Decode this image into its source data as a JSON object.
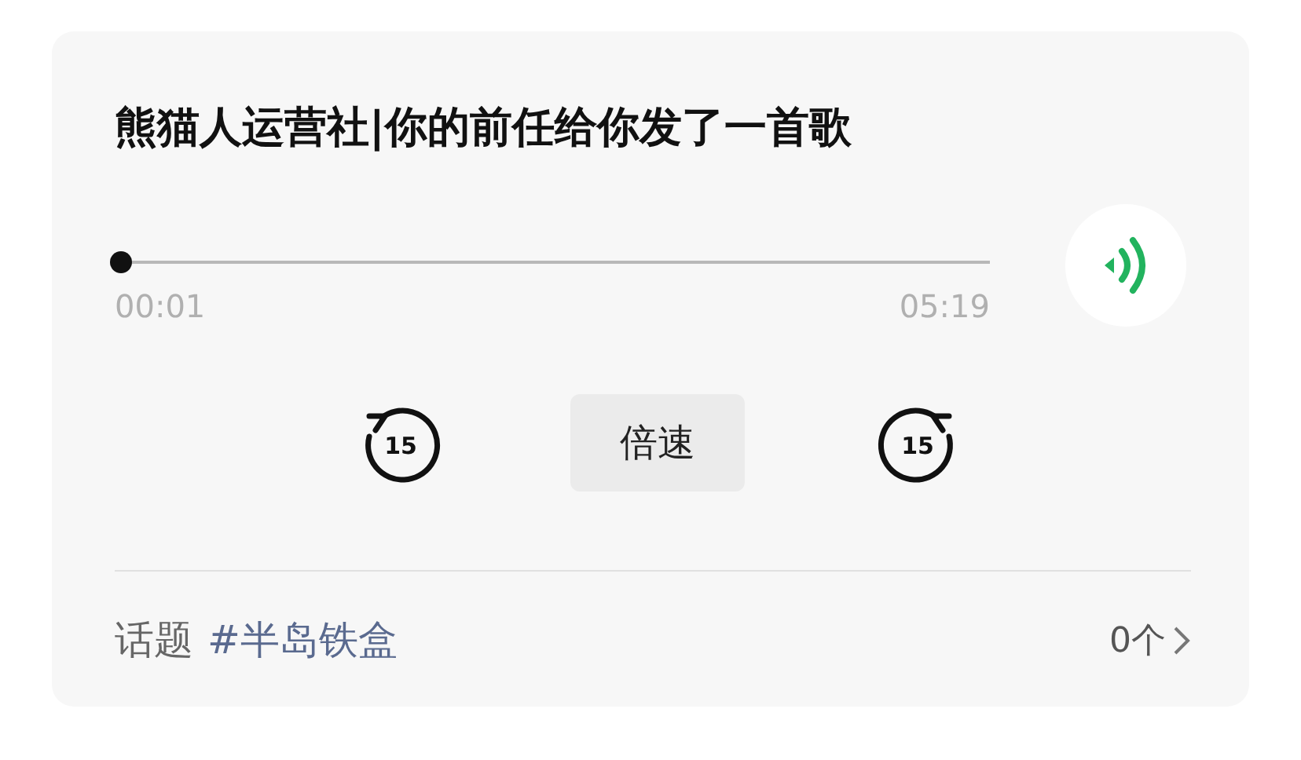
{
  "title": "熊猫人运营社|你的前任给你发了一首歌",
  "player": {
    "level": 0.003,
    "elapsed": "00:01",
    "duration": "05:19",
    "rewind": "15",
    "forward": "15",
    "speed_button": "倍速"
  },
  "footer": {
    "label": "话题",
    "topic": "#半岛铁盒",
    "count": "0个"
  }
}
